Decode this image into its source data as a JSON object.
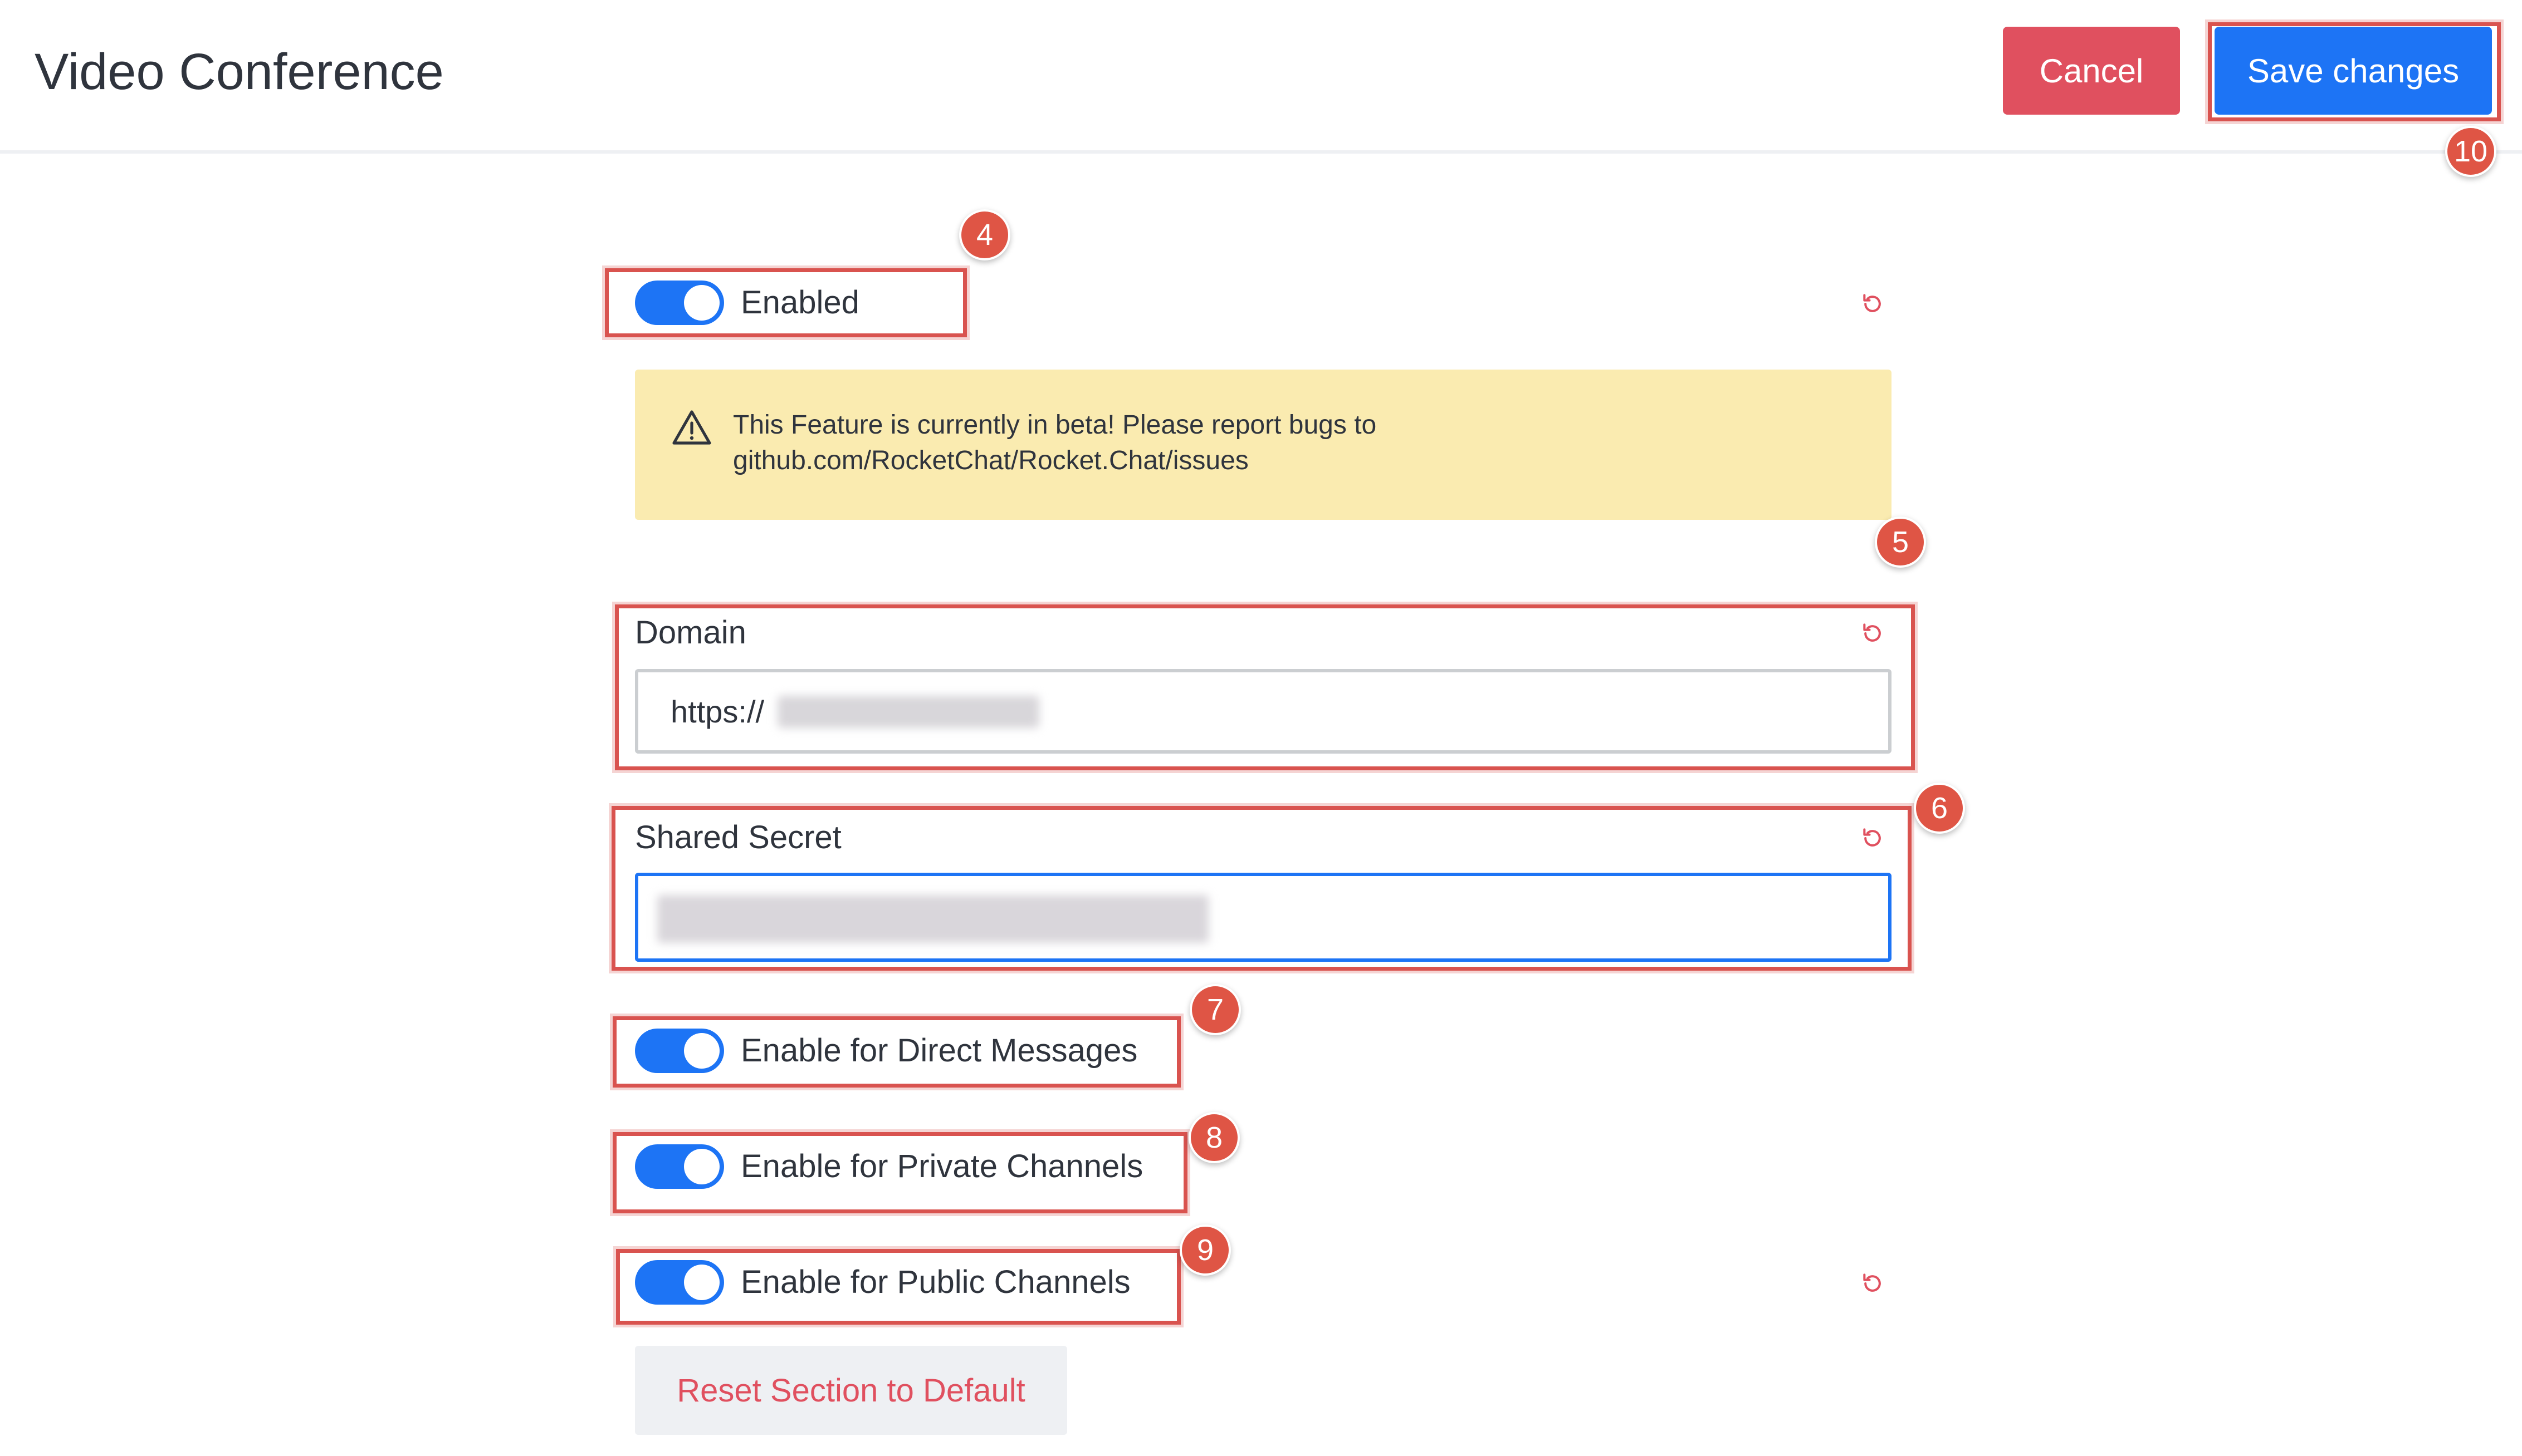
{
  "header": {
    "title": "Video Conference",
    "cancel_label": "Cancel",
    "save_label": "Save changes"
  },
  "settings": {
    "enabled_label": "Enabled",
    "beta_notice_line1": "This Feature is currently in beta! Please report bugs to",
    "beta_notice_line2": "github.com/RocketChat/Rocket.Chat/issues",
    "domain": {
      "label": "Domain",
      "value_visible": "https://"
    },
    "shared_secret": {
      "label": "Shared Secret"
    },
    "toggles": {
      "direct_messages": "Enable for Direct Messages",
      "private_channels": "Enable for Private Channels",
      "public_channels": "Enable for Public Channels"
    },
    "reset_section_label": "Reset Section to Default"
  },
  "annotations": [
    "4",
    "5",
    "6",
    "7",
    "8",
    "9",
    "10"
  ],
  "colors": {
    "primary": "#1d74f5",
    "danger": "#e0505f",
    "warning_bg": "#faebb0",
    "annotation": "#d9534f"
  },
  "icons": {
    "reset": "reset-icon",
    "warning": "warning-icon"
  }
}
